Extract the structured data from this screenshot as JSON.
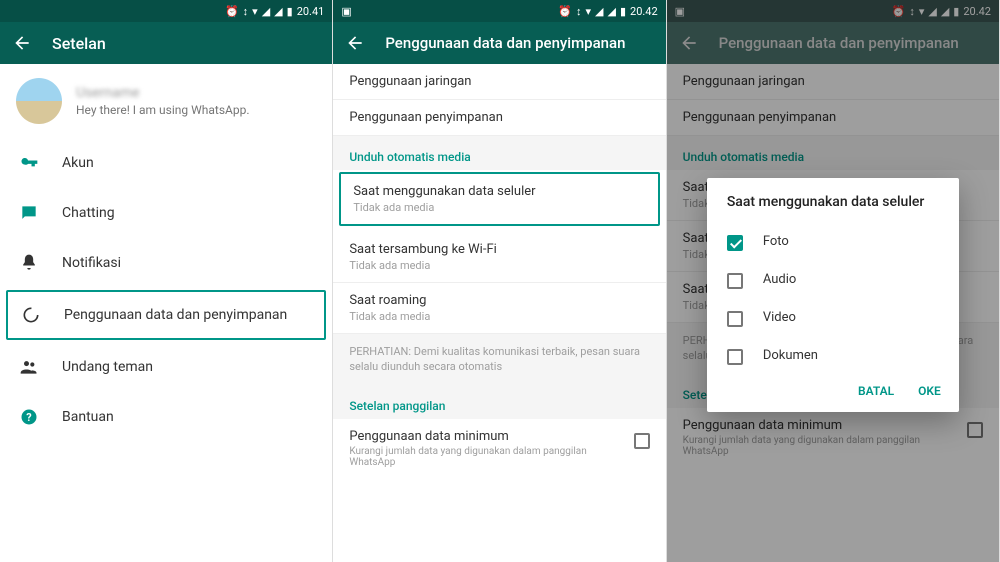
{
  "screen1": {
    "status_time": "20.41",
    "appbar_title": "Setelan",
    "profile_name": "Username",
    "profile_status": "Hey there! I am using WhatsApp.",
    "items": [
      {
        "icon": "key",
        "label": "Akun"
      },
      {
        "icon": "chat",
        "label": "Chatting"
      },
      {
        "icon": "bell",
        "label": "Notifikasi"
      },
      {
        "icon": "data",
        "label": "Penggunaan data dan penyimpanan",
        "highlight": true
      },
      {
        "icon": "friends",
        "label": "Undang teman"
      },
      {
        "icon": "help",
        "label": "Bantuan"
      }
    ]
  },
  "screen2": {
    "status_time": "20.42",
    "appbar_title": "Penggunaan data dan penyimpanan",
    "top_items": [
      {
        "title": "Penggunaan jaringan"
      },
      {
        "title": "Penggunaan penyimpanan"
      }
    ],
    "section1": "Unduh otomatis media",
    "media_items": [
      {
        "title": "Saat menggunakan data seluler",
        "sub": "Tidak ada media",
        "highlight": true
      },
      {
        "title": "Saat tersambung ke Wi-Fi",
        "sub": "Tidak ada media"
      },
      {
        "title": "Saat roaming",
        "sub": "Tidak ada media"
      }
    ],
    "note": "PERHATIAN: Demi kualitas komunikasi terbaik, pesan suara selalu diunduh secara otomatis",
    "section2": "Setelan panggilan",
    "call_item_title": "Penggunaan data minimum",
    "call_item_sub": "Kurangi jumlah data yang digunakan dalam panggilan WhatsApp"
  },
  "screen3": {
    "status_time": "20.42",
    "appbar_title": "Penggunaan data dan penyimpanan",
    "dialog_title": "Saat menggunakan data seluler",
    "options": [
      {
        "label": "Foto",
        "checked": true
      },
      {
        "label": "Audio",
        "checked": false
      },
      {
        "label": "Video",
        "checked": false
      },
      {
        "label": "Dokumen",
        "checked": false
      }
    ],
    "cancel": "BATAL",
    "ok": "OKE"
  }
}
